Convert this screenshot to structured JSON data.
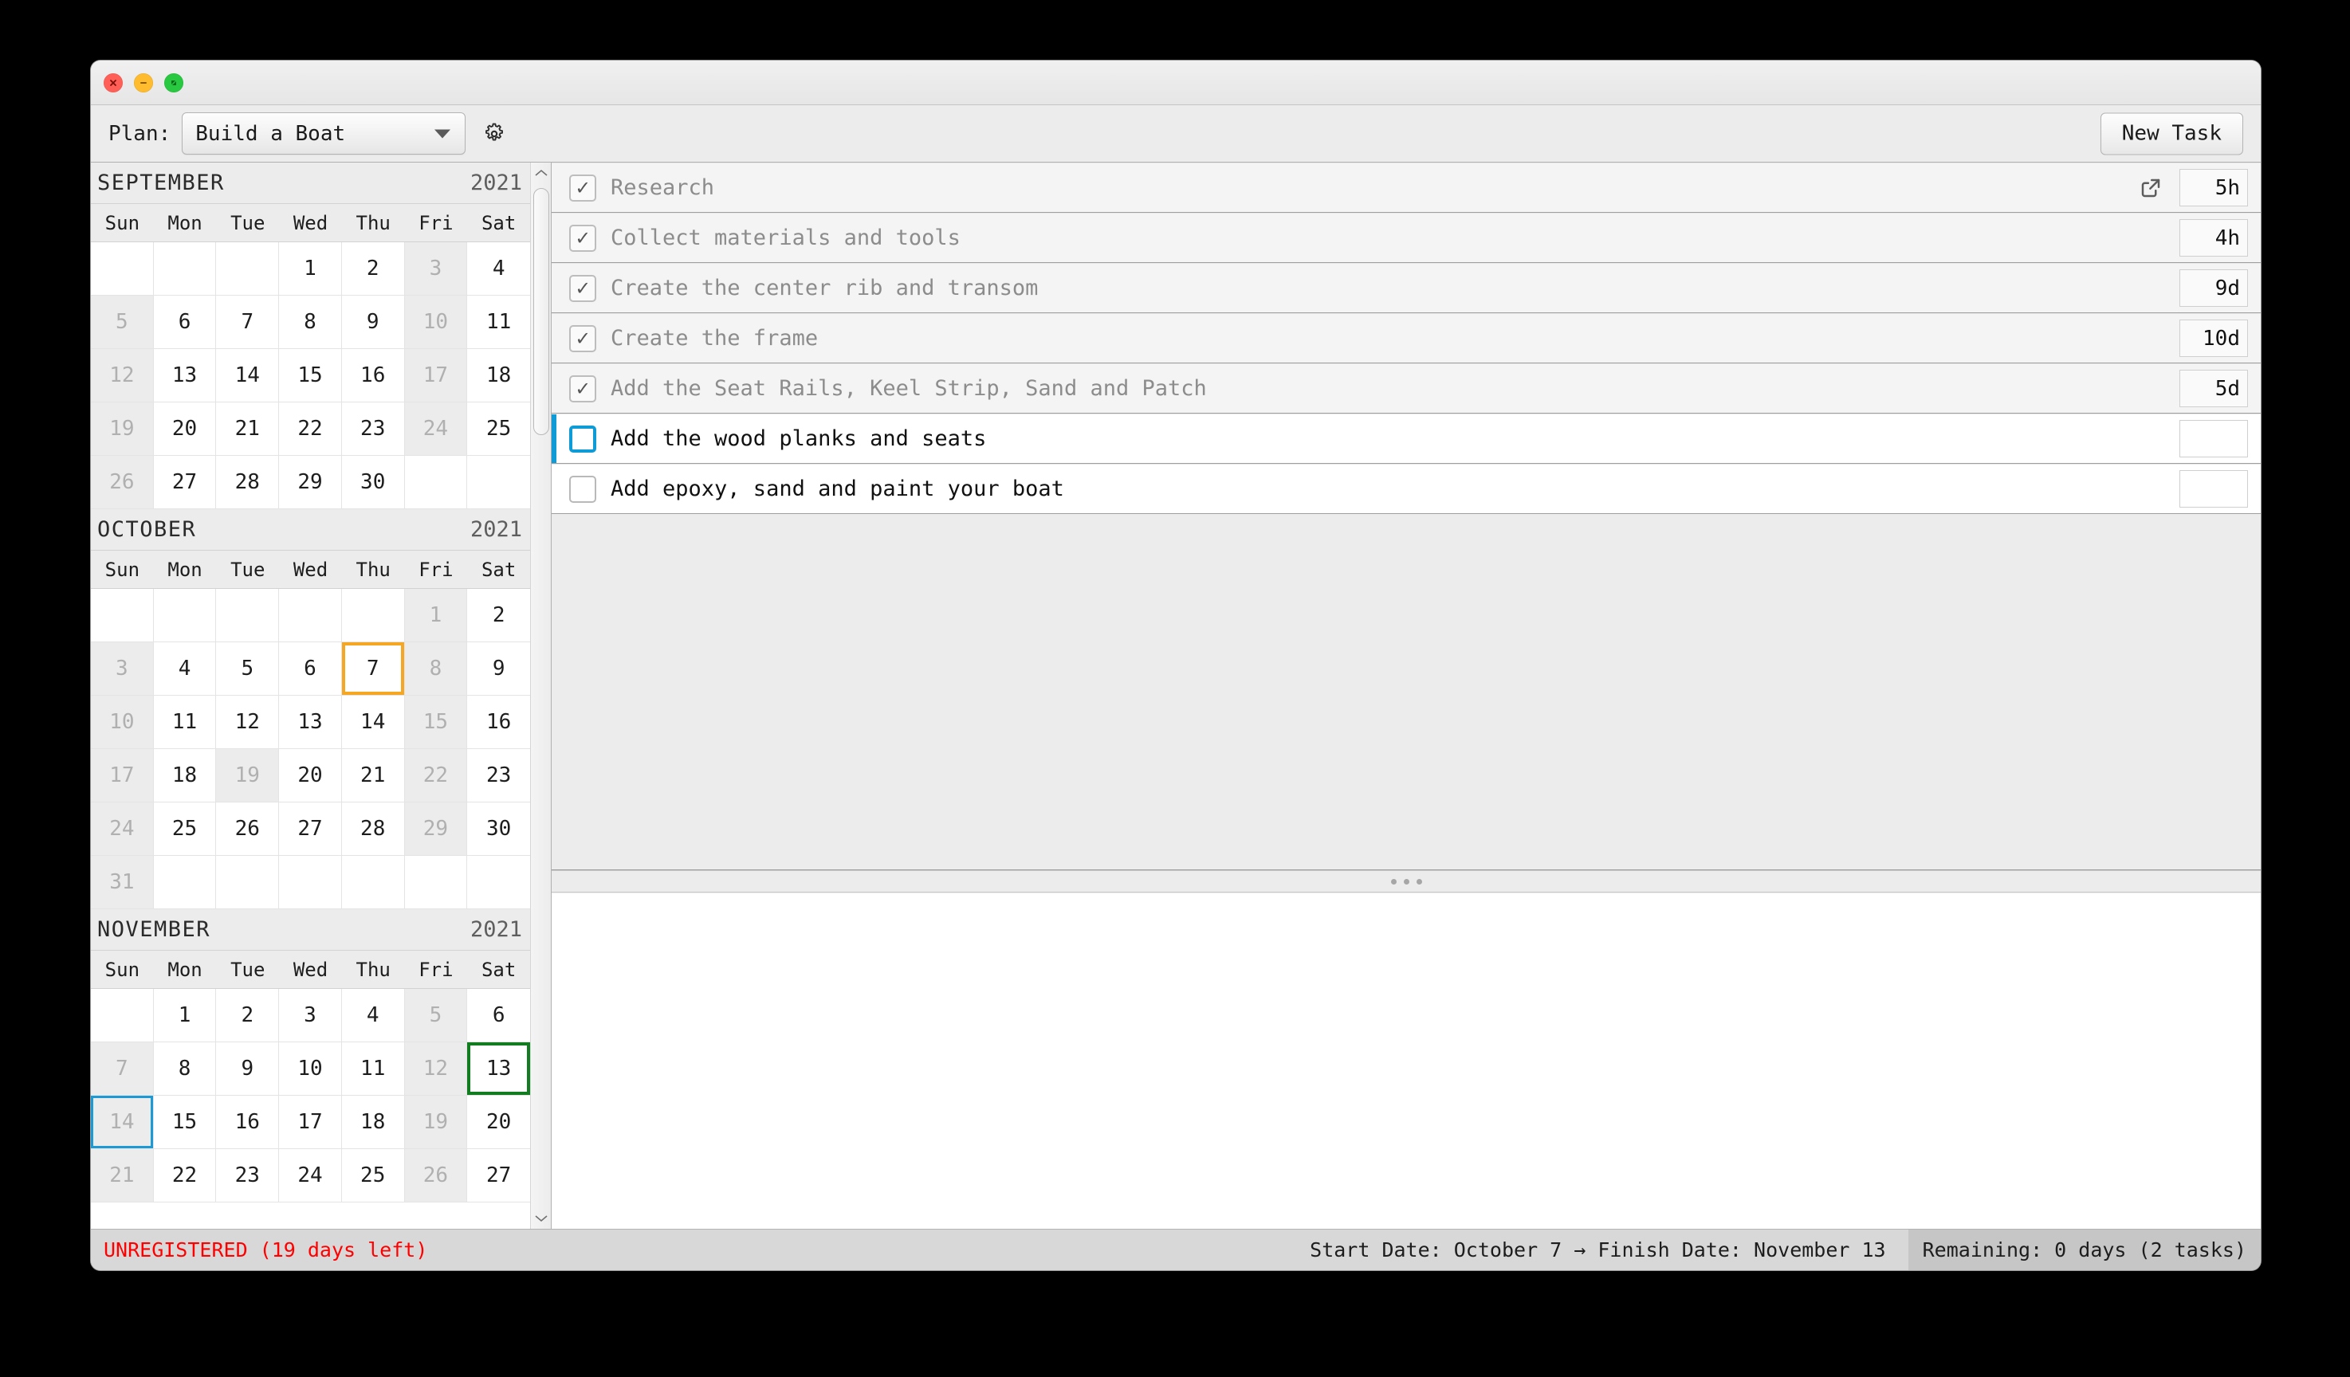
{
  "window": {
    "traffic_lights": [
      {
        "name": "close-button",
        "glyph": "✕",
        "color": "#ff5f57"
      },
      {
        "name": "minimize-button",
        "glyph": "–",
        "color": "#febc2e"
      },
      {
        "name": "maximize-button",
        "glyph": "◢",
        "color": "#28c840"
      }
    ]
  },
  "toolbar": {
    "plan_label": "Plan:",
    "plan_value": "Build a Boat",
    "settings_icon": "gear-icon",
    "new_task_label": "New Task"
  },
  "calendar": {
    "weekday_headers": [
      "Sun",
      "Mon",
      "Tue",
      "Wed",
      "Thu",
      "Fri",
      "Sat"
    ],
    "months": [
      {
        "name": "SEPTEMBER",
        "year": "2021",
        "weeks": [
          [
            {
              "d": "",
              "t": "blank"
            },
            {
              "d": "",
              "t": "blank"
            },
            {
              "d": "",
              "t": "blank"
            },
            {
              "d": "1",
              "t": "on"
            },
            {
              "d": "2",
              "t": "on"
            },
            {
              "d": "3",
              "t": "off"
            },
            {
              "d": "4",
              "t": "on"
            }
          ],
          [
            {
              "d": "5",
              "t": "off"
            },
            {
              "d": "6",
              "t": "on"
            },
            {
              "d": "7",
              "t": "on"
            },
            {
              "d": "8",
              "t": "on"
            },
            {
              "d": "9",
              "t": "on"
            },
            {
              "d": "10",
              "t": "off"
            },
            {
              "d": "11",
              "t": "on"
            }
          ],
          [
            {
              "d": "12",
              "t": "off"
            },
            {
              "d": "13",
              "t": "on"
            },
            {
              "d": "14",
              "t": "on"
            },
            {
              "d": "15",
              "t": "on"
            },
            {
              "d": "16",
              "t": "on"
            },
            {
              "d": "17",
              "t": "off"
            },
            {
              "d": "18",
              "t": "on"
            }
          ],
          [
            {
              "d": "19",
              "t": "off"
            },
            {
              "d": "20",
              "t": "on"
            },
            {
              "d": "21",
              "t": "on"
            },
            {
              "d": "22",
              "t": "on"
            },
            {
              "d": "23",
              "t": "on"
            },
            {
              "d": "24",
              "t": "off"
            },
            {
              "d": "25",
              "t": "on"
            }
          ],
          [
            {
              "d": "26",
              "t": "off"
            },
            {
              "d": "27",
              "t": "on"
            },
            {
              "d": "28",
              "t": "on"
            },
            {
              "d": "29",
              "t": "on"
            },
            {
              "d": "30",
              "t": "on"
            },
            {
              "d": "",
              "t": "blank"
            },
            {
              "d": "",
              "t": "blank"
            }
          ]
        ]
      },
      {
        "name": "OCTOBER",
        "year": "2021",
        "weeks": [
          [
            {
              "d": "",
              "t": "blank"
            },
            {
              "d": "",
              "t": "blank"
            },
            {
              "d": "",
              "t": "blank"
            },
            {
              "d": "",
              "t": "blank"
            },
            {
              "d": "",
              "t": "blank"
            },
            {
              "d": "1",
              "t": "off"
            },
            {
              "d": "2",
              "t": "on"
            }
          ],
          [
            {
              "d": "3",
              "t": "off"
            },
            {
              "d": "4",
              "t": "on"
            },
            {
              "d": "5",
              "t": "on"
            },
            {
              "d": "6",
              "t": "on"
            },
            {
              "d": "7",
              "t": "on",
              "mark": "start"
            },
            {
              "d": "8",
              "t": "off"
            },
            {
              "d": "9",
              "t": "on"
            }
          ],
          [
            {
              "d": "10",
              "t": "off"
            },
            {
              "d": "11",
              "t": "on"
            },
            {
              "d": "12",
              "t": "on"
            },
            {
              "d": "13",
              "t": "on"
            },
            {
              "d": "14",
              "t": "on"
            },
            {
              "d": "15",
              "t": "off"
            },
            {
              "d": "16",
              "t": "on"
            }
          ],
          [
            {
              "d": "17",
              "t": "off"
            },
            {
              "d": "18",
              "t": "on"
            },
            {
              "d": "19",
              "t": "off"
            },
            {
              "d": "20",
              "t": "on"
            },
            {
              "d": "21",
              "t": "on"
            },
            {
              "d": "22",
              "t": "off"
            },
            {
              "d": "23",
              "t": "on"
            }
          ],
          [
            {
              "d": "24",
              "t": "off"
            },
            {
              "d": "25",
              "t": "on"
            },
            {
              "d": "26",
              "t": "on"
            },
            {
              "d": "27",
              "t": "on"
            },
            {
              "d": "28",
              "t": "on"
            },
            {
              "d": "29",
              "t": "off"
            },
            {
              "d": "30",
              "t": "on"
            }
          ],
          [
            {
              "d": "31",
              "t": "off"
            },
            {
              "d": "",
              "t": "blank"
            },
            {
              "d": "",
              "t": "blank"
            },
            {
              "d": "",
              "t": "blank"
            },
            {
              "d": "",
              "t": "blank"
            },
            {
              "d": "",
              "t": "blank"
            },
            {
              "d": "",
              "t": "blank"
            }
          ]
        ]
      },
      {
        "name": "NOVEMBER",
        "year": "2021",
        "weeks": [
          [
            {
              "d": "",
              "t": "blank"
            },
            {
              "d": "1",
              "t": "on"
            },
            {
              "d": "2",
              "t": "on"
            },
            {
              "d": "3",
              "t": "on"
            },
            {
              "d": "4",
              "t": "on"
            },
            {
              "d": "5",
              "t": "off"
            },
            {
              "d": "6",
              "t": "on"
            }
          ],
          [
            {
              "d": "7",
              "t": "off"
            },
            {
              "d": "8",
              "t": "on"
            },
            {
              "d": "9",
              "t": "on"
            },
            {
              "d": "10",
              "t": "on"
            },
            {
              "d": "11",
              "t": "on"
            },
            {
              "d": "12",
              "t": "off"
            },
            {
              "d": "13",
              "t": "on",
              "mark": "finish"
            }
          ],
          [
            {
              "d": "14",
              "t": "off",
              "mark": "today"
            },
            {
              "d": "15",
              "t": "on"
            },
            {
              "d": "16",
              "t": "on"
            },
            {
              "d": "17",
              "t": "on"
            },
            {
              "d": "18",
              "t": "on"
            },
            {
              "d": "19",
              "t": "off"
            },
            {
              "d": "20",
              "t": "on"
            }
          ],
          [
            {
              "d": "21",
              "t": "off"
            },
            {
              "d": "22",
              "t": "on"
            },
            {
              "d": "23",
              "t": "on"
            },
            {
              "d": "24",
              "t": "on"
            },
            {
              "d": "25",
              "t": "on"
            },
            {
              "d": "26",
              "t": "off"
            },
            {
              "d": "27",
              "t": "on"
            }
          ]
        ]
      }
    ]
  },
  "tasks": [
    {
      "title": "Research",
      "done": true,
      "selected": false,
      "duration": "5h",
      "has_link": true
    },
    {
      "title": "Collect materials and tools",
      "done": true,
      "selected": false,
      "duration": "4h",
      "has_link": false
    },
    {
      "title": "Create the center rib and transom",
      "done": true,
      "selected": false,
      "duration": "9d",
      "has_link": false
    },
    {
      "title": "Create the frame",
      "done": true,
      "selected": false,
      "duration": "10d",
      "has_link": false
    },
    {
      "title": "Add the Seat Rails, Keel Strip, Sand and Patch",
      "done": true,
      "selected": false,
      "duration": "5d",
      "has_link": false
    },
    {
      "title": "Add the wood planks and seats",
      "done": false,
      "selected": true,
      "duration": "",
      "has_link": false
    },
    {
      "title": "Add epoxy, sand and paint your boat",
      "done": false,
      "selected": false,
      "duration": "",
      "has_link": false
    }
  ],
  "statusbar": {
    "unregistered": "UNREGISTERED (19 days left)",
    "dates": "Start Date: October 7 → Finish Date: November 13",
    "remaining": "Remaining: 0 days (2 tasks)"
  },
  "colors": {
    "start_date": "#f5a623",
    "finish_date": "#127c21",
    "today": "#1c9ad6",
    "selection": "#0e9bd6",
    "warning_text": "#ff0000"
  }
}
